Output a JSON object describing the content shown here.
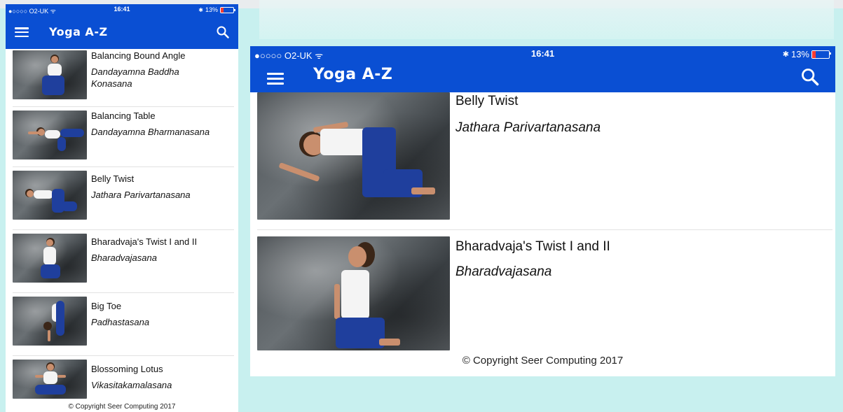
{
  "app": {
    "title": "Yoga A-Z",
    "copyright": "© Copyright Seer Computing 2017"
  },
  "status_bar": {
    "carrier": "●○○○○ O2-UK ᯤ",
    "time": "16:41",
    "bluetooth": "✱",
    "battery": "13%",
    "battery_level": 0.13
  },
  "colors": {
    "app_bar": "#0a4fd3",
    "background": "#c8f0ef",
    "battery_low": "#ff3b30"
  },
  "icons": {
    "menu": "hamburger-menu-icon",
    "search": "search-icon",
    "wifi": "wifi-icon",
    "bluetooth": "bluetooth-icon",
    "battery": "battery-icon"
  },
  "phone_list": [
    {
      "name": "Balancing Bound Angle",
      "sanskrit": "Dandayamna Baddha Konasana"
    },
    {
      "name": "Balancing Table",
      "sanskrit": "Dandayamna Bharmanasana"
    },
    {
      "name": "Belly Twist",
      "sanskrit": "Jathara Parivartanasana"
    },
    {
      "name": "Bharadvaja's Twist I and II",
      "sanskrit": "Bharadvajasana"
    },
    {
      "name": "Big Toe",
      "sanskrit": "Padhastasana"
    },
    {
      "name": "Blossoming Lotus",
      "sanskrit": "Vikasitakamalasana"
    }
  ],
  "tablet_list": [
    {
      "name": "Belly Twist",
      "sanskrit": "Jathara Parivartanasana"
    },
    {
      "name": "Bharadvaja's Twist I and II",
      "sanskrit": "Bharadvajasana"
    }
  ]
}
